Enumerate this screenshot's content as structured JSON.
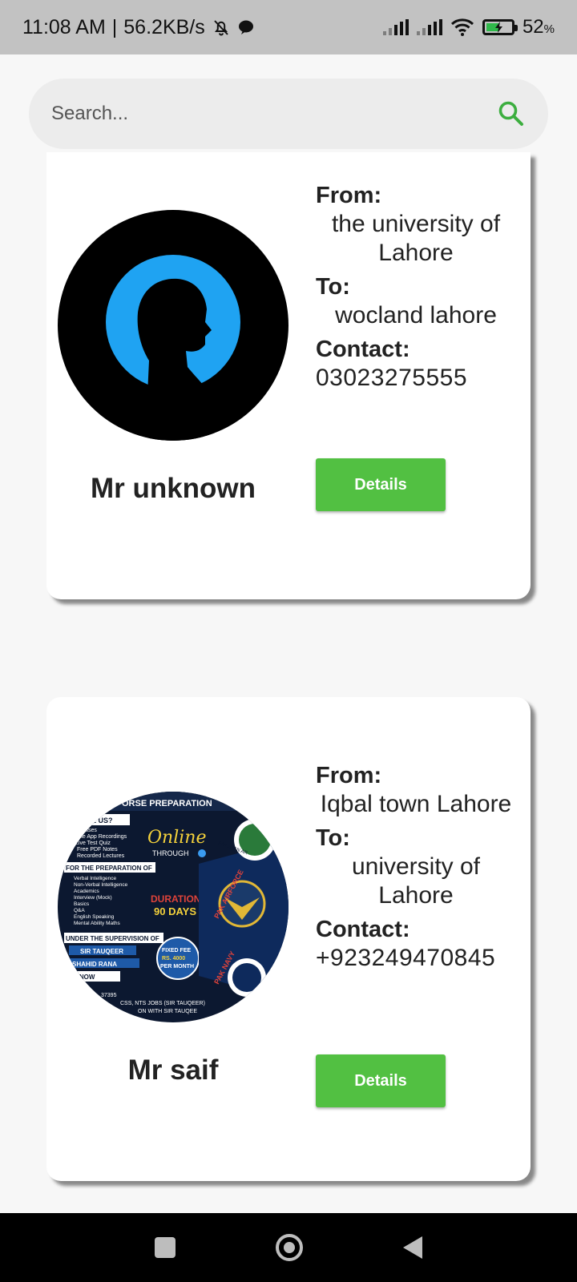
{
  "status_bar": {
    "time": "11:08 AM",
    "speed": "56.2KB/s",
    "battery": "52",
    "battery_unit": "%",
    "battery_level": 0.52,
    "icons": [
      "mute-bell-icon",
      "chat-bubble-icon",
      "signal-icon",
      "signal-icon",
      "wifi-icon",
      "battery-charging-icon"
    ]
  },
  "search": {
    "placeholder": "Search...",
    "icon": "search-icon",
    "accent": "#3cae3f"
  },
  "contacts": [
    {
      "name": "Mr unknown",
      "avatar": "silhouette-avatar",
      "from_label": "From:",
      "from": "the university of Lahore",
      "to_label": "To:",
      "to": "wocland lahore",
      "contact_label": "Contact:",
      "contact": "03023275555",
      "button": "Details"
    },
    {
      "name": "Mr saif",
      "avatar": "course-poster-avatar",
      "from_label": "From:",
      "from": "Iqbal town Lahore",
      "to_label": "To:",
      "to": "university of Lahore",
      "contact_label": "Contact:",
      "contact": "+923249470845",
      "button": "Details"
    }
  ],
  "poster": {
    "header": "ORSE PREPARATION",
    "why": "OOSE US?",
    "features": [
      "Classes",
      "obile App Recordings",
      "Live Test Quiz",
      "Free PDF Notes",
      "Recorded Lectures"
    ],
    "online": "Online",
    "through": "THROUGH",
    "prep_title": "FOR THE PREPARATION OF",
    "prep_items": [
      "Verbal Intelligence",
      "Non-Verbal Intelligence",
      "Academics",
      "Interview (Mock)",
      "Basics",
      "Q&A",
      "English Speaking",
      "Mental Ability Maths"
    ],
    "duration": "DURATION",
    "days": "90 DAYS",
    "supervision": "UNDER THE SUPERVISION OF",
    "teacher1": "SIR TAUQEER",
    "teacher2": "R SHAHID RANA",
    "act": "CT NOW",
    "fee1": "FIXED FEE",
    "fee2": "RS. 4000",
    "fee3": "PER MONTH",
    "airforce": "PAK AIRFORCE",
    "navy": "PAK NAVY",
    "army": "PAKISTAN AR",
    "footer1": "37395",
    "footer2": "CSS, NTS JOBS (SIR TAUQEER)",
    "footer3": "ON WITH SIR TAUQEE"
  },
  "nav_bar": {
    "buttons": [
      "recents-button",
      "home-button",
      "back-button"
    ]
  }
}
